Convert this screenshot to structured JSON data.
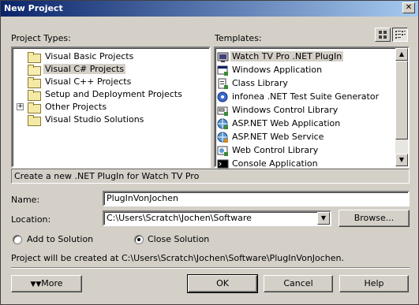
{
  "window": {
    "title": "New Project",
    "close_glyph": "✕"
  },
  "project_types": {
    "label": "Project Types:",
    "items": [
      {
        "label": "Visual Basic Projects",
        "icon": "folder-icon"
      },
      {
        "label": "Visual C# Projects",
        "icon": "folder-open-icon",
        "selected": true
      },
      {
        "label": "Visual C++ Projects",
        "icon": "folder-icon"
      },
      {
        "label": "Setup and Deployment Projects",
        "icon": "folder-icon"
      },
      {
        "label": "Other Projects",
        "icon": "folder-icon",
        "expander": "+"
      },
      {
        "label": "Visual Studio Solutions",
        "icon": "folder-icon"
      }
    ]
  },
  "templates": {
    "label": "Templates:",
    "items": [
      {
        "label": "Watch TV Pro .NET PlugIn",
        "icon": "tv-plugin-icon",
        "selected": true
      },
      {
        "label": "Windows Application",
        "icon": "windows-app-icon"
      },
      {
        "label": "Class Library",
        "icon": "class-library-icon"
      },
      {
        "label": "infonea .NET Test Suite Generator",
        "icon": "test-suite-icon"
      },
      {
        "label": "Windows Control Library",
        "icon": "control-library-icon"
      },
      {
        "label": "ASP.NET Web Application",
        "icon": "web-app-icon"
      },
      {
        "label": "ASP.NET Web Service",
        "icon": "web-service-icon"
      },
      {
        "label": "Web Control Library",
        "icon": "web-control-icon"
      },
      {
        "label": "Console Application",
        "icon": "console-app-icon"
      }
    ]
  },
  "description": "Create a new .NET PlugIn for Watch TV Pro",
  "form": {
    "name_label": "Name:",
    "name_value": "PlugInVonJochen",
    "location_label": "Location:",
    "location_value": "C:\\Users\\Scratch\\Jochen\\Software",
    "browse_label": "Browse...",
    "add_to_solution_label": "Add to Solution",
    "close_solution_label": "Close Solution",
    "close_solution_selected": true
  },
  "project_path_text": "Project will be created at C:\\Users\\Scratch\\Jochen\\Software\\PlugInVonJochen.",
  "buttons": {
    "more": "More",
    "ok": "OK",
    "cancel": "Cancel",
    "help": "Help"
  },
  "colors": {
    "title_start": "#0a246a",
    "title_end": "#a6caf0",
    "face": "#d4d0c8"
  }
}
